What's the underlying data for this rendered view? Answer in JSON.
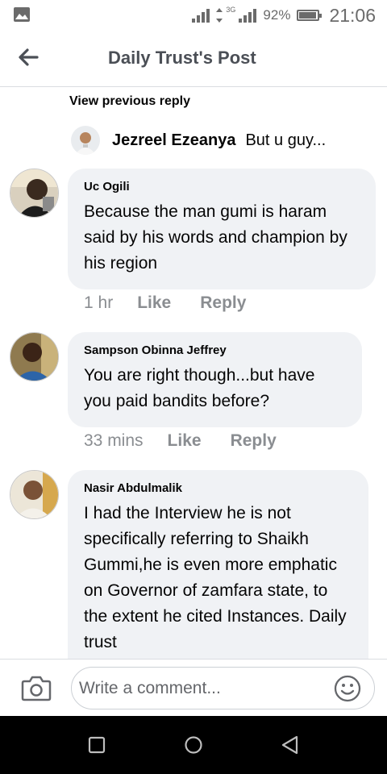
{
  "status_bar": {
    "network_tag": "3G",
    "battery_percent": "92%",
    "battery_level": 0.92,
    "time": "21:06"
  },
  "header": {
    "title": "Daily Trust's Post"
  },
  "thread": {
    "view_previous_label": "View previous reply",
    "reply_preview": {
      "author": "Jezreel Ezeanya",
      "text": "But u guy..."
    }
  },
  "comments": [
    {
      "author": "Uc Ogili",
      "text": "Because the man gumi is haram said by his words and champion by his region",
      "time": "1 hr",
      "like_label": "Like",
      "reply_label": "Reply"
    },
    {
      "author": "Sampson Obinna Jeffrey",
      "text": "You are right though...but have you paid bandits before?",
      "time": "33 mins",
      "like_label": "Like",
      "reply_label": "Reply"
    },
    {
      "author": "Nasir Abdulmalik",
      "text": "I had the Interview he is not specifically referring to Shaikh Gummi,he is even more emphatic on Governor of zamfara state, to the extent he cited Instances. Daily trust"
    }
  ],
  "composer": {
    "placeholder": "Write a comment..."
  },
  "icons": {
    "gallery": "gallery-icon",
    "back": "back-arrow-icon",
    "camera": "camera-icon",
    "emoji": "emoji-icon",
    "recents": "recents-square-icon",
    "home": "home-circle-icon",
    "nav_back": "back-triangle-icon"
  },
  "colors": {
    "bubble": "#f0f2f5",
    "meta_text": "#8a8d91",
    "header_title": "#4b4f56",
    "nav_bar": "#000000"
  }
}
